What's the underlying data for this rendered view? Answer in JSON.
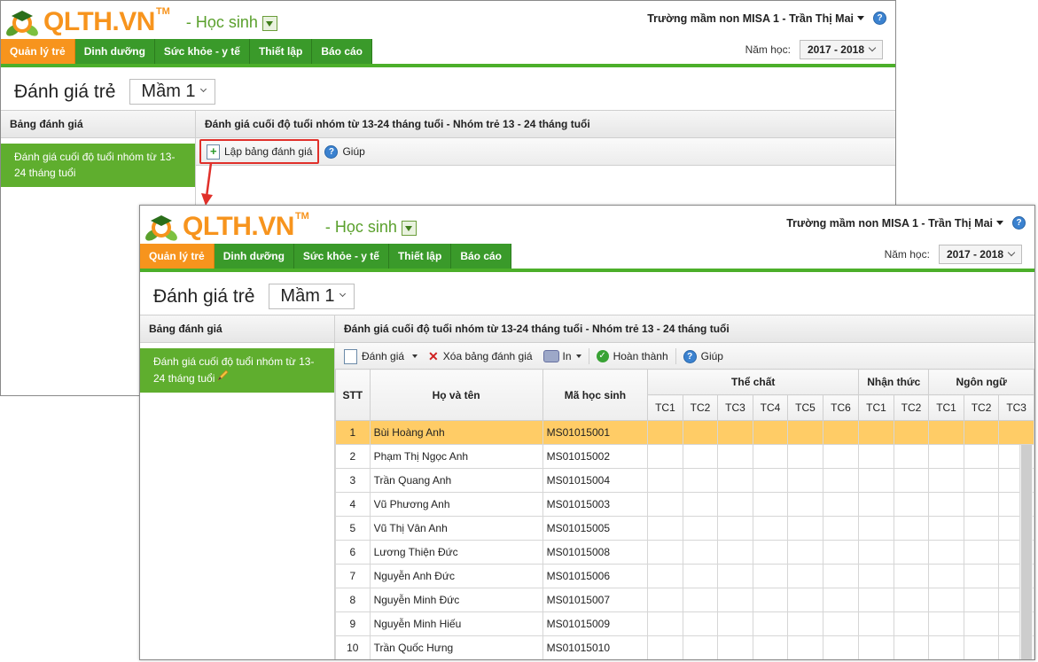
{
  "app": {
    "logo_text": "QLTH.VN",
    "logo_tm": "TM",
    "module": "- Học sinh",
    "user": "Trường mầm non MISA 1 - Trần Thị Mai",
    "help_glyph": "?"
  },
  "tabs": [
    "Quản lý trẻ",
    "Dinh dưỡng",
    "Sức khỏe - y tế",
    "Thiết lập",
    "Báo cáo"
  ],
  "year": {
    "label": "Năm học:",
    "value": "2017 - 2018"
  },
  "page": {
    "title": "Đánh giá trẻ",
    "level": "Mầm 1"
  },
  "sidebar": {
    "header": "Bảng đánh giá",
    "item": "Đánh giá cuối độ tuổi nhóm từ 13-24 tháng tuổi"
  },
  "main": {
    "header": "Đánh giá cuối độ tuổi nhóm từ 13-24 tháng tuổi - Nhóm trẻ 13 - 24 tháng tuổi"
  },
  "toolbar1": {
    "create": "Lập bảng đánh giá",
    "help": "Giúp"
  },
  "toolbar2": {
    "evaluate": "Đánh giá",
    "delete": "Xóa bảng đánh giá",
    "print": "In",
    "complete": "Hoàn thành",
    "help": "Giúp"
  },
  "table": {
    "headers": {
      "stt": "STT",
      "name": "Họ và tên",
      "code": "Mã học sinh"
    },
    "groups": [
      "Thể chất",
      "Nhận thức",
      "Ngôn ngữ"
    ],
    "subcols": [
      "TC1",
      "TC2",
      "TC3",
      "TC4",
      "TC5",
      "TC6",
      "TC1",
      "TC2",
      "TC1",
      "TC2",
      "TC3"
    ],
    "rows": [
      [
        "1",
        "Bùi Hoàng Anh",
        "MS01015001"
      ],
      [
        "2",
        "Phạm Thị Ngọc Anh",
        "MS01015002"
      ],
      [
        "3",
        "Trần Quang Anh",
        "MS01015004"
      ],
      [
        "4",
        "Vũ Phương Anh",
        "MS01015003"
      ],
      [
        "5",
        "Vũ Thị Vân Anh",
        "MS01015005"
      ],
      [
        "6",
        "Lương Thiện Đức",
        "MS01015008"
      ],
      [
        "7",
        "Nguyễn Anh Đức",
        "MS01015006"
      ],
      [
        "8",
        "Nguyễn Minh Đức",
        "MS01015007"
      ],
      [
        "9",
        "Nguyễn Minh Hiếu",
        "MS01015009"
      ],
      [
        "10",
        "Trần Quốc Hưng",
        "MS01015010"
      ]
    ],
    "selected_row": 0
  },
  "colors": {
    "orange": "#f7941d",
    "green": "#3a9a2a",
    "sidebar_green": "#5fae2e",
    "selected_row": "#ffcc66",
    "callout_red": "#e0302a"
  }
}
